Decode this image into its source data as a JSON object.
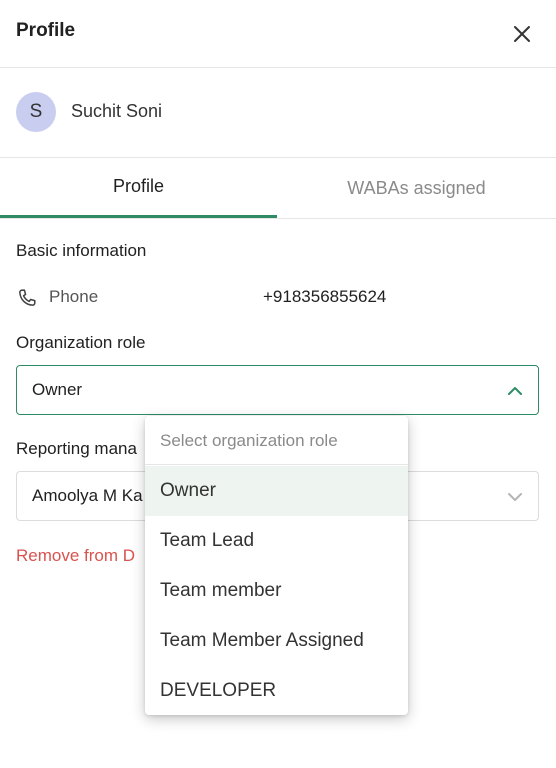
{
  "header": {
    "title": "Profile"
  },
  "user": {
    "initial": "S",
    "name": "Suchit Soni"
  },
  "tabs": [
    {
      "label": "Profile"
    },
    {
      "label": "WABAs assigned"
    }
  ],
  "basic_info": {
    "title": "Basic information",
    "phone_label": "Phone",
    "phone_value": "+918356855624"
  },
  "org_role": {
    "label": "Organization role",
    "value": "Owner"
  },
  "reporting_manager": {
    "label": "Reporting mana",
    "value": "Amoolya M Ka"
  },
  "remove_link": "Remove from D",
  "dropdown": {
    "placeholder": "Select organization role",
    "options": [
      "Owner",
      "Team Lead",
      "Team member",
      "Team Member Assigned",
      "DEVELOPER"
    ],
    "selected": "Owner"
  },
  "colors": {
    "accent": "#2e8b66",
    "danger": "#d9534f",
    "avatar_bg": "#c9cdf0",
    "selected_option_bg": "#eef4f0"
  }
}
